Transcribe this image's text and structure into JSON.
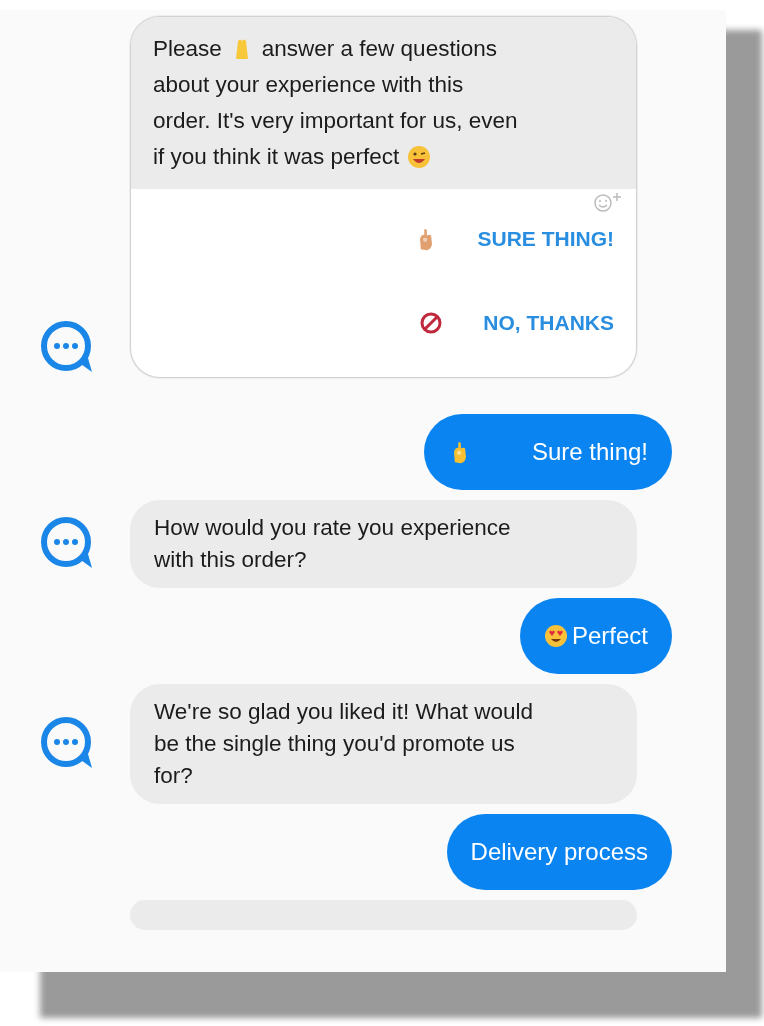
{
  "messages": [
    {
      "kind": "bot_card",
      "lines": [
        [
          {
            "text": "Please",
            "emoji_after": true
          },
          {
            "text": "answer a few questions",
            "emoji_after": false
          }
        ],
        [
          {
            "text": "about your experience with this",
            "emoji_after": false
          }
        ],
        [
          {
            "text": "order. It's very important for us, even",
            "emoji_after": false
          }
        ],
        [
          {
            "text": "if you think it was perfect",
            "emoji_after": true
          }
        ]
      ],
      "options": [
        {
          "label": "SURE THING!",
          "kind": "accept"
        },
        {
          "label": "NO, THANKS",
          "kind": "decline"
        }
      ]
    },
    {
      "kind": "user_ok",
      "text": "Sure thing!"
    },
    {
      "kind": "bot",
      "text": "How would you rate you experience with this order?"
    },
    {
      "kind": "user_love",
      "text": "Perfect"
    },
    {
      "kind": "bot",
      "text": "We're so glad you liked it! What would be the single thing you'd promote us for?"
    },
    {
      "kind": "user",
      "text": "Delivery process"
    },
    {
      "kind": "bot_cut"
    }
  ]
}
